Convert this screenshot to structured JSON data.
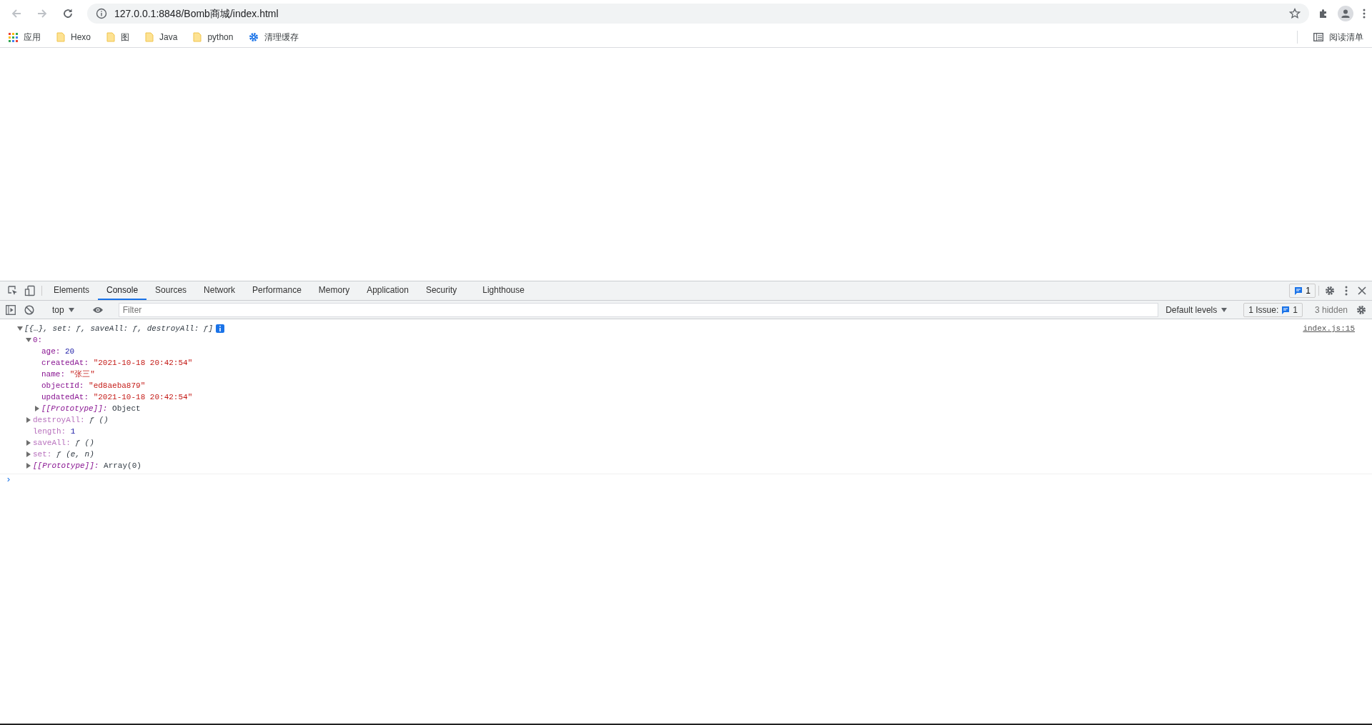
{
  "browser": {
    "address": "127.0.0.1:8848/Bomb商城/index.html",
    "bookmarks": [
      {
        "label": "应用",
        "kind": "apps"
      },
      {
        "label": "Hexo",
        "kind": "folder"
      },
      {
        "label": "图",
        "kind": "folder"
      },
      {
        "label": "Java",
        "kind": "folder"
      },
      {
        "label": "python",
        "kind": "folder"
      },
      {
        "label": "清理缓存",
        "kind": "link"
      }
    ],
    "reading_list": "阅读清单"
  },
  "devtools": {
    "tabs": [
      {
        "label": "Elements",
        "selected": false
      },
      {
        "label": "Console",
        "selected": true
      },
      {
        "label": "Sources",
        "selected": false
      },
      {
        "label": "Network",
        "selected": false
      },
      {
        "label": "Performance",
        "selected": false
      },
      {
        "label": "Memory",
        "selected": false
      },
      {
        "label": "Application",
        "selected": false
      },
      {
        "label": "Security",
        "selected": false
      },
      {
        "label": "Lighthouse",
        "selected": false
      }
    ],
    "issues_badge": "1",
    "console_toolbar": {
      "context": "top",
      "filter_placeholder": "Filter",
      "levels": "Default levels",
      "issues_label": "1 Issue:",
      "issues_count": "1",
      "hidden": "3 hidden"
    },
    "log": {
      "summary": "[{…}, set: ƒ, saveAll: ƒ, destroyAll: ƒ]",
      "source": "index.js:15",
      "expanded": true,
      "children": [
        {
          "key": "0:",
          "dimmed": false,
          "internal": false,
          "kind": "plain",
          "expanded": true,
          "children": [
            {
              "key": "age:",
              "dimmed": false,
              "internal": false,
              "value": "20",
              "kind": "number"
            },
            {
              "key": "createdAt:",
              "dimmed": false,
              "internal": false,
              "value": "\"2021-10-18 20:42:54\"",
              "kind": "string"
            },
            {
              "key": "name:",
              "dimmed": false,
              "internal": false,
              "value": "\"张三\"",
              "kind": "string"
            },
            {
              "key": "objectId:",
              "dimmed": false,
              "internal": false,
              "value": "\"ed8aeba879\"",
              "kind": "string"
            },
            {
              "key": "updatedAt:",
              "dimmed": false,
              "internal": false,
              "value": "\"2021-10-18 20:42:54\"",
              "kind": "string"
            },
            {
              "key": "[[Prototype]]:",
              "dimmed": false,
              "internal": true,
              "value": "Object",
              "kind": "plain",
              "expanded": false
            }
          ]
        },
        {
          "key": "destroyAll:",
          "dimmed": true,
          "internal": false,
          "value": "ƒ ()",
          "kind": "function",
          "expanded": false
        },
        {
          "key": "length:",
          "dimmed": true,
          "internal": false,
          "value": "1",
          "kind": "number"
        },
        {
          "key": "saveAll:",
          "dimmed": true,
          "internal": false,
          "value": "ƒ ()",
          "kind": "function",
          "expanded": false
        },
        {
          "key": "set:",
          "dimmed": true,
          "internal": false,
          "value": "ƒ (e, n)",
          "kind": "function",
          "expanded": false
        },
        {
          "key": "[[Prototype]]:",
          "dimmed": false,
          "internal": true,
          "value": "Array(0)",
          "kind": "plain",
          "expanded": false
        }
      ]
    },
    "prompt": "›"
  }
}
